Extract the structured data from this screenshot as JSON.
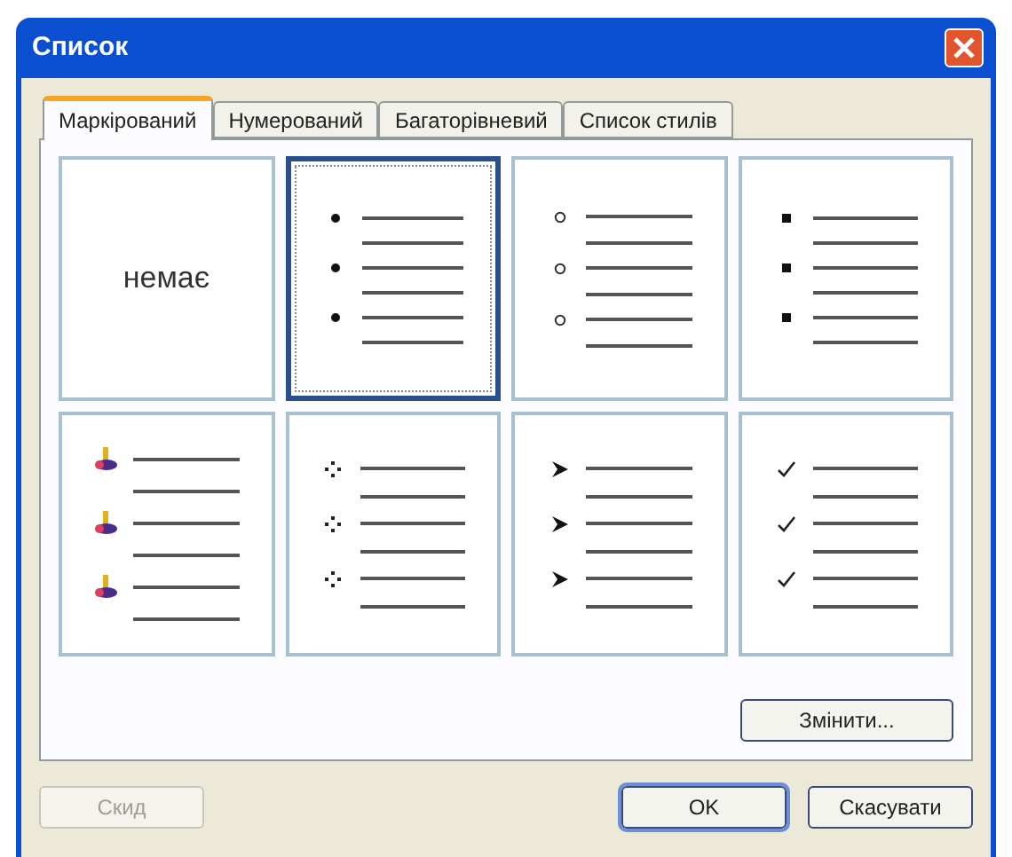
{
  "window": {
    "title": "Список"
  },
  "tabs": [
    {
      "label": "Маркірований",
      "selected": true
    },
    {
      "label": "Нумерований",
      "selected": false
    },
    {
      "label": "Багаторівневий",
      "selected": false
    },
    {
      "label": "Список стилів",
      "selected": false
    }
  ],
  "styles": [
    {
      "kind": "none",
      "label": "немає",
      "selected": false
    },
    {
      "kind": "dot",
      "selected": true
    },
    {
      "kind": "circle",
      "selected": false
    },
    {
      "kind": "square",
      "selected": false
    },
    {
      "kind": "picture-bullet",
      "selected": false
    },
    {
      "kind": "four-dots",
      "selected": false
    },
    {
      "kind": "arrow",
      "selected": false
    },
    {
      "kind": "check",
      "selected": false
    }
  ],
  "change_button": "Змінити...",
  "buttons": [
    {
      "label": "Скид",
      "disabled": true,
      "default": false
    },
    {
      "label": "OK",
      "disabled": false,
      "default": true
    },
    {
      "label": "Скасувати",
      "disabled": false,
      "default": false
    }
  ]
}
